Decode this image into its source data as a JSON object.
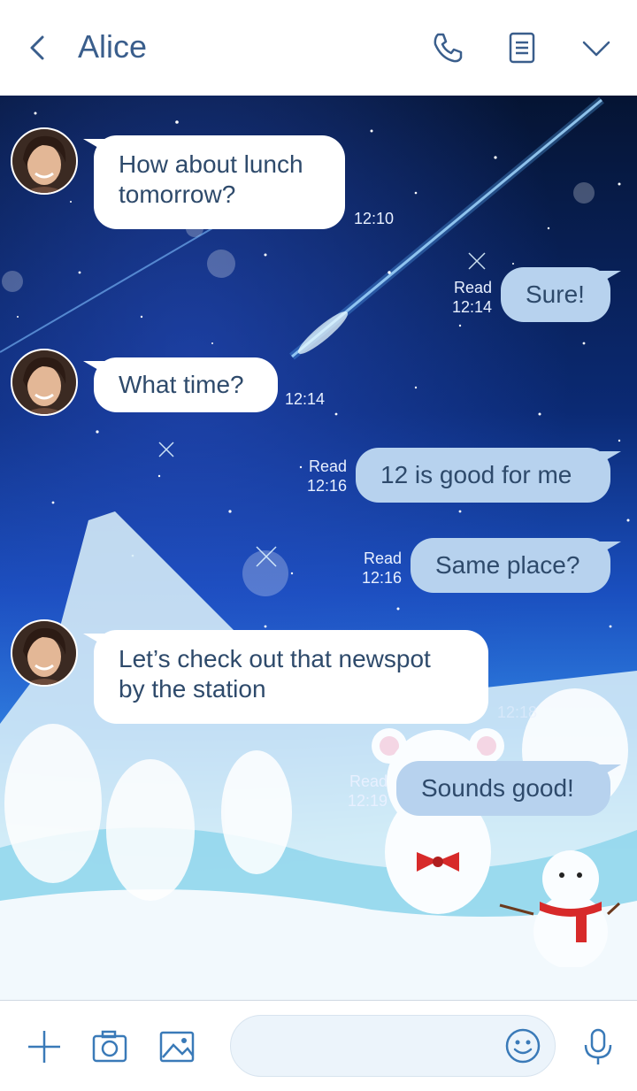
{
  "header": {
    "title": "Alice",
    "icons": [
      "back-icon",
      "phone-icon",
      "notes-icon",
      "chevron-down-icon"
    ]
  },
  "messages": [
    {
      "from": "Alice",
      "direction": "in",
      "text_lines": [
        "How about lunch",
        "tomorrow?"
      ],
      "time": "12:10"
    },
    {
      "direction": "out",
      "text": "Sure!",
      "read": "Read",
      "time": "12:14"
    },
    {
      "from": "Alice",
      "direction": "in",
      "text": "What time?",
      "time": "12:14"
    },
    {
      "direction": "out",
      "text": "12 is good for me",
      "read": "Read",
      "time": "12:16"
    },
    {
      "direction": "out",
      "text": "Same place?",
      "read": "Read",
      "time": "12:16"
    },
    {
      "from": "Alice",
      "direction": "in",
      "text_lines": [
        "Let’s check out that newspot",
        "by the station"
      ],
      "time": "12:18"
    },
    {
      "direction": "out",
      "text": "Sounds good!",
      "read": "Read",
      "time": "12:19"
    }
  ],
  "bottombar": {
    "icons": [
      "plus-icon",
      "camera-icon",
      "image-icon",
      "emoji-icon",
      "microphone-icon"
    ],
    "input_placeholder": ""
  },
  "colors": {
    "accent": "#3a5e8c",
    "bubble_out": "#b7d2ee",
    "bubble_in": "#ffffff"
  }
}
